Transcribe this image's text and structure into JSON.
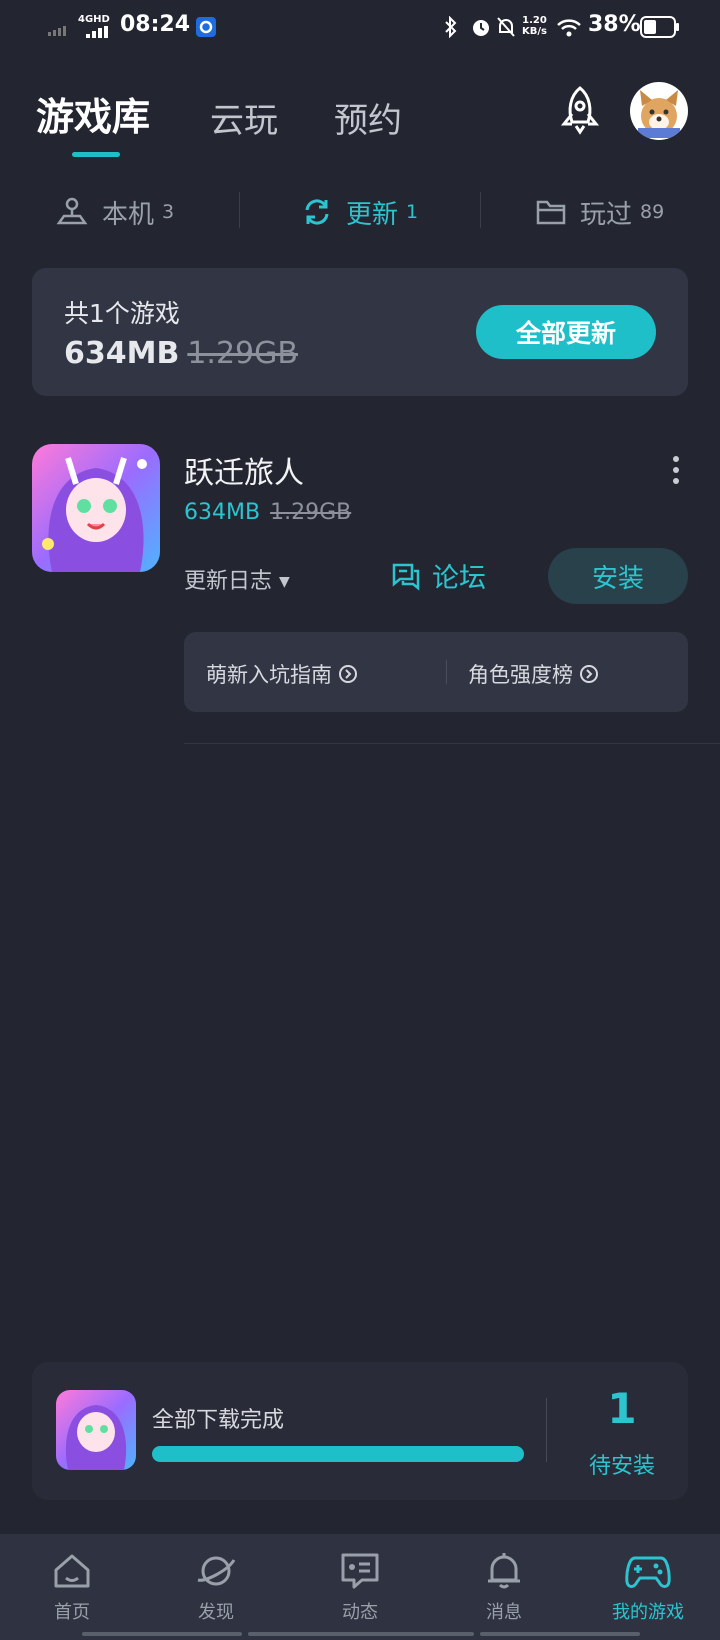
{
  "status_bar": {
    "network": "4GHD",
    "time": "08:24",
    "speed_value": "1.20",
    "speed_unit": "KB/s",
    "battery": "38%"
  },
  "top_tabs": [
    "游戏库",
    "云玩",
    "预约"
  ],
  "sub_tabs": [
    {
      "label": "本机",
      "count": "3"
    },
    {
      "label": "更新",
      "count": "1"
    },
    {
      "label": "玩过",
      "count": "89"
    }
  ],
  "summary": {
    "count_text": "共1个游戏",
    "size": "634MB",
    "original_size": "1.29GB",
    "update_all": "全部更新"
  },
  "game": {
    "name": "跃迁旅人",
    "size": "634MB",
    "original_size": "1.29GB",
    "changelog": "更新日志",
    "forum": "论坛",
    "install": "安装",
    "links": [
      "萌新入坑指南",
      "角色强度榜"
    ]
  },
  "download": {
    "status": "全部下载完成",
    "progress": 1.0,
    "pending_count": "1",
    "pending_label": "待安装"
  },
  "bottom_nav": [
    {
      "label": "首页",
      "icon": "home-icon"
    },
    {
      "label": "发现",
      "icon": "planet-icon"
    },
    {
      "label": "动态",
      "icon": "chat-card-icon"
    },
    {
      "label": "消息",
      "icon": "bell-icon"
    },
    {
      "label": "我的游戏",
      "icon": "gamepad-icon"
    }
  ],
  "colors": {
    "accent": "#1fbfc9",
    "background": "#232631",
    "card": "#323644"
  }
}
